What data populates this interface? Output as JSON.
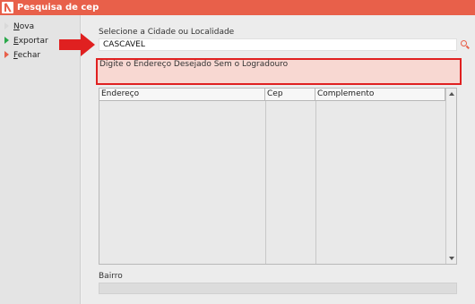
{
  "window": {
    "title": "Pesquisa de cep"
  },
  "sidebar": {
    "items": [
      {
        "label_u": "N",
        "label_rest": "ova",
        "icon": "arrow-right-icon"
      },
      {
        "label_u": "E",
        "label_rest": "xportar",
        "icon": "arrow-right-icon-green"
      },
      {
        "label_u": "F",
        "label_rest": "echar",
        "icon": "arrow-right-icon-red"
      }
    ]
  },
  "form": {
    "cidade_label": "Selecione a Cidade ou Localidade",
    "cidade_value": "CASCAVEL",
    "endereco_label": "Digite o Endereço Desejado Sem o Logradouro",
    "bairro_label": "Bairro",
    "bairro_value": ""
  },
  "grid": {
    "columns": [
      "Endereço",
      "Cep",
      "Complemento"
    ],
    "rows": []
  },
  "colors": {
    "accent": "#e8604a",
    "highlight_border": "#e02020",
    "highlight_fill": "#f8d8d2",
    "export_icon": "#2aa84a"
  }
}
